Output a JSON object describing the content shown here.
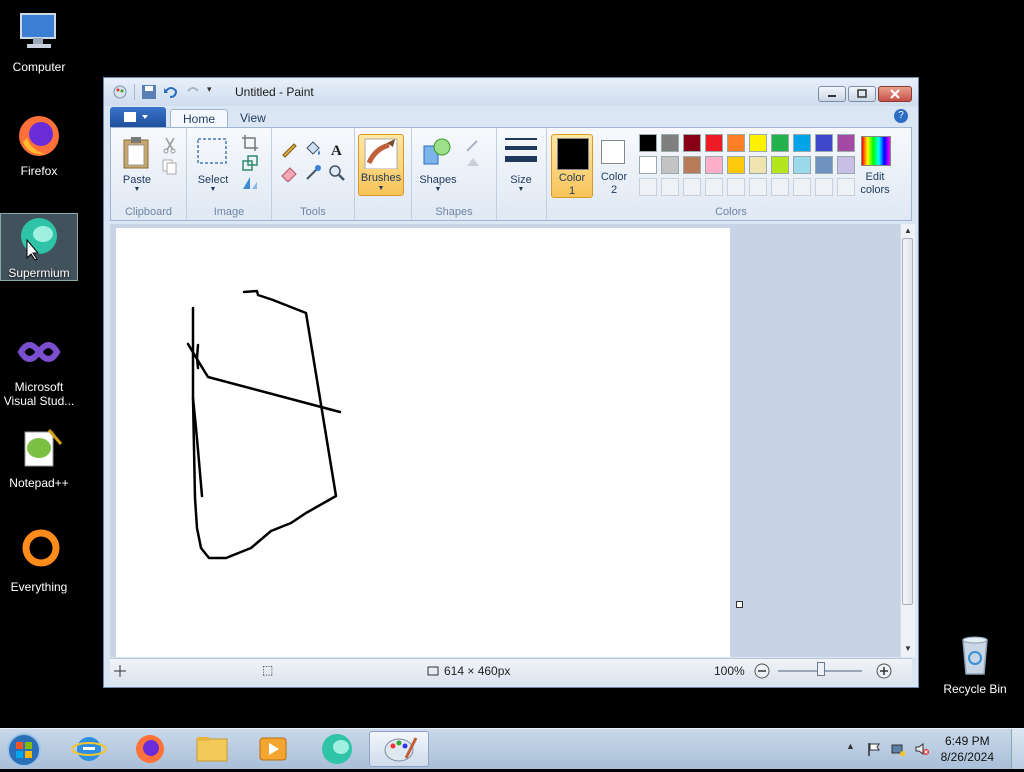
{
  "desktop": {
    "icons": [
      {
        "label": "Computer"
      },
      {
        "label": "Firefox"
      },
      {
        "label": "Supermium"
      },
      {
        "label": "Microsoft Visual Stud..."
      },
      {
        "label": "Notepad++"
      },
      {
        "label": "Everything"
      },
      {
        "label": "Recycle Bin"
      }
    ]
  },
  "window": {
    "title": "Untitled - Paint",
    "tabs": {
      "home": "Home",
      "view": "View"
    },
    "ribbon": {
      "clipboard": {
        "group": "Clipboard",
        "paste": "Paste"
      },
      "image": {
        "group": "Image",
        "select": "Select"
      },
      "tools": {
        "group": "Tools"
      },
      "brushes": {
        "label": "Brushes"
      },
      "shapes": {
        "group": "Shapes",
        "label": "Shapes"
      },
      "size": {
        "label": "Size"
      },
      "colors": {
        "group": "Colors",
        "color1_line1": "Color",
        "color1_line2": "1",
        "color2_line1": "Color",
        "color2_line2": "2",
        "edit_line1": "Edit",
        "edit_line2": "colors",
        "palette_row1": [
          "#000000",
          "#7f7f7f",
          "#880015",
          "#ed1c24",
          "#ff7f27",
          "#fff200",
          "#22b14c",
          "#00a2e8",
          "#3f48cc",
          "#a349a4"
        ],
        "palette_row2": [
          "#ffffff",
          "#c3c3c3",
          "#b97a57",
          "#ffaec9",
          "#ffc90e",
          "#efe4b0",
          "#b5e61d",
          "#99d9ea",
          "#7092be",
          "#c8bfe7"
        ]
      }
    },
    "status": {
      "dimensions": "614 × 460px",
      "zoom": "100%"
    }
  },
  "taskbar": {
    "time": "6:49 PM",
    "date": "8/26/2024"
  }
}
